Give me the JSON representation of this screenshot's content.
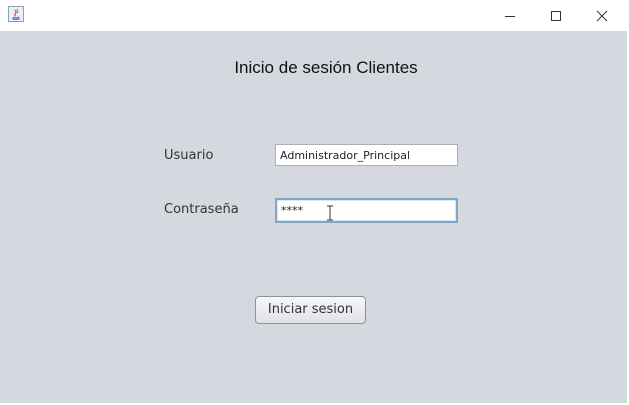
{
  "window": {
    "controls": {
      "minimize_icon": "minimize-icon",
      "maximize_icon": "maximize-icon",
      "close_icon": "close-icon"
    }
  },
  "form": {
    "heading": "Inicio de sesión Clientes",
    "username_label": "Usuario",
    "username_value": "Administrador_Principal",
    "password_label": "Contraseña",
    "password_value": "****",
    "submit_label": "Iniciar sesion"
  },
  "colors": {
    "panel_background": "#d5d8de",
    "focus_border": "#7fa8c9"
  }
}
